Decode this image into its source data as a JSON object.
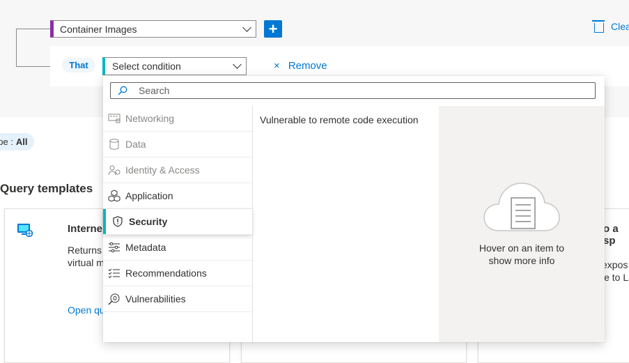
{
  "builder": {
    "entity_value": "Container Images",
    "add_label": "+",
    "clear_label": "Clea",
    "that_label": "That",
    "condition_placeholder": "Select condition",
    "remove_label": "Remove",
    "remove_icon": "×"
  },
  "scope": {
    "label": "ope :",
    "value": "All"
  },
  "query_templates": {
    "heading": "Query templates",
    "cards": [
      {
        "title": "Interne",
        "desc_line1": "Returns",
        "desc_line2": "virtual m",
        "link": "Open qu"
      },
      {
        "title": "o a sp",
        "desc_line1": "expos",
        "desc_line2": "le to L"
      }
    ]
  },
  "dropdown": {
    "search_placeholder": "Search",
    "categories": [
      {
        "label": "Networking",
        "icon": "network-icon",
        "disabled": true
      },
      {
        "label": "Data",
        "icon": "database-icon",
        "disabled": true
      },
      {
        "label": "Identity & Access",
        "icon": "identity-icon",
        "disabled": true
      },
      {
        "label": "Application",
        "icon": "cubes-icon",
        "disabled": false
      },
      {
        "label": "Security",
        "icon": "shield-icon",
        "disabled": false,
        "selected": true
      },
      {
        "label": "Metadata",
        "icon": "sliders-icon",
        "disabled": false
      },
      {
        "label": "Recommendations",
        "icon": "checklist-icon",
        "disabled": false
      },
      {
        "label": "Vulnerabilities",
        "icon": "bug-search-icon",
        "disabled": false
      }
    ],
    "options": [
      "Vulnerable to remote code execution"
    ],
    "info_text_line1": "Hover on an item to",
    "info_text_line2": "show more info"
  },
  "colors": {
    "accent": "#0078d4",
    "entity_bar": "#8a2da5",
    "condition_bar": "#00b7c3"
  }
}
